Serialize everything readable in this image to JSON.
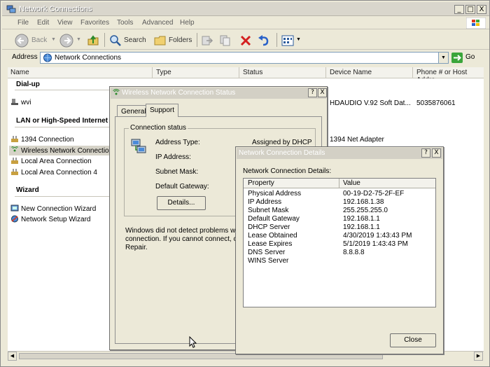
{
  "window": {
    "title": "Network Connections",
    "min": "_",
    "max": "□",
    "close": "X"
  },
  "menu": [
    "File",
    "Edit",
    "View",
    "Favorites",
    "Tools",
    "Advanced",
    "Help"
  ],
  "toolbar": {
    "back": "Back",
    "search": "Search",
    "folders": "Folders"
  },
  "address": {
    "label": "Address",
    "value": "Network Connections",
    "go": "Go"
  },
  "columns": {
    "name": "Name",
    "type": "Type",
    "status": "Status",
    "device": "Device Name",
    "phone": "Phone # or Host Addre"
  },
  "groups": {
    "dialup": "Dial-up",
    "lan": "LAN or High-Speed Internet",
    "wizard": "Wizard"
  },
  "dialup_items": [
    {
      "name": "wvi",
      "device": "HDAUDIO V.92 Soft Dat...",
      "phone": "5035876061"
    }
  ],
  "lan_items": [
    {
      "name": "1394 Connection",
      "device": "1394 Net Adapter"
    },
    {
      "name": "Wireless Network Connection"
    },
    {
      "name": "Local Area Connection"
    },
    {
      "name": "Local Area Connection 4"
    }
  ],
  "wizard_items": [
    {
      "name": "New Connection Wizard"
    },
    {
      "name": "Network Setup Wizard"
    }
  ],
  "status_dialog": {
    "title": "Wireless Network Connection Status",
    "tabs": [
      "General",
      "Support"
    ],
    "group_label": "Connection status",
    "fields": [
      {
        "label": "Address Type:",
        "value": "Assigned by DHCP"
      },
      {
        "label": "IP Address:",
        "value": ""
      },
      {
        "label": "Subnet Mask:",
        "value": ""
      },
      {
        "label": "Default Gateway:",
        "value": ""
      }
    ],
    "details_button": "Details...",
    "message_line1": "Windows did not detect problems with",
    "message_line2": "connection. If you cannot connect, cli",
    "message_line3": "Repair.",
    "help_btn": "?",
    "close_btn": "X"
  },
  "details_dialog": {
    "title": "Network Connection Details",
    "label": "Network Connection Details:",
    "col_property": "Property",
    "col_value": "Value",
    "rows": [
      {
        "p": "Physical Address",
        "v": "00-19-D2-75-2F-EF"
      },
      {
        "p": "IP Address",
        "v": "192.168.1.38"
      },
      {
        "p": "Subnet Mask",
        "v": "255.255.255.0"
      },
      {
        "p": "Default Gateway",
        "v": "192.168.1.1"
      },
      {
        "p": "DHCP Server",
        "v": "192.168.1.1"
      },
      {
        "p": "Lease Obtained",
        "v": "4/30/2019 1:43:43 PM"
      },
      {
        "p": "Lease Expires",
        "v": "5/1/2019 1:43:43 PM"
      },
      {
        "p": "DNS Server",
        "v": "8.8.8.8"
      },
      {
        "p": "WINS Server",
        "v": ""
      }
    ],
    "close_button": "Close",
    "help_btn": "?",
    "close_btn": "X"
  }
}
